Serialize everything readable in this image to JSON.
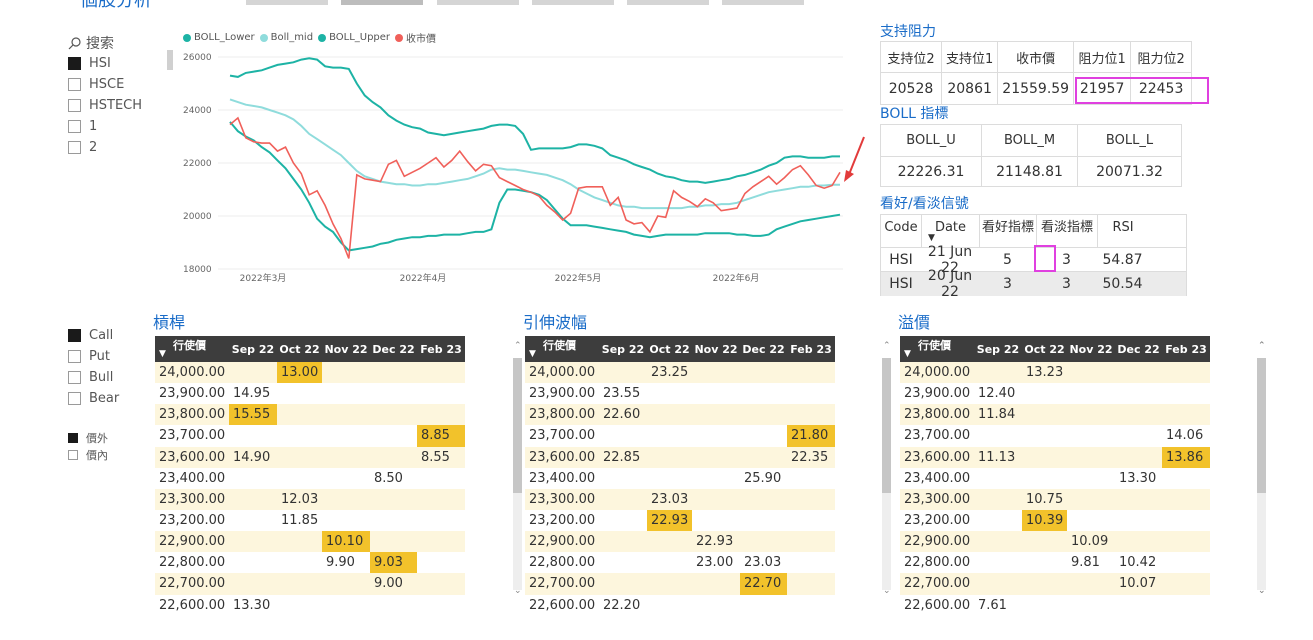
{
  "header": {
    "title": "個股分析"
  },
  "slicer": {
    "search_placeholder": "搜索",
    "items": [
      {
        "label": "HSI",
        "checked": true
      },
      {
        "label": "HSCE",
        "checked": false
      },
      {
        "label": "HSTECH",
        "checked": false
      },
      {
        "label": "1",
        "checked": false
      },
      {
        "label": "2",
        "checked": false
      }
    ]
  },
  "type_slicer": {
    "items": [
      {
        "label": "Call",
        "checked": true
      },
      {
        "label": "Put",
        "checked": false
      },
      {
        "label": "Bull",
        "checked": false
      },
      {
        "label": "Bear",
        "checked": false
      }
    ]
  },
  "money_slicer": {
    "items": [
      {
        "label": "價外",
        "checked": true
      },
      {
        "label": "價內",
        "checked": false
      }
    ]
  },
  "chart_data": {
    "type": "line",
    "legend": [
      "BOLL_Lower",
      "Boll_mid",
      "BOLL_Upper",
      "收市價"
    ],
    "legend_position": "top-left",
    "colors": {
      "BOLL_Lower": "#1db3a5",
      "Boll_mid": "#8fdcdc",
      "BOLL_Upper": "#1db3a5",
      "收市價": "#f0605a"
    },
    "yticks": [
      "26000",
      "24000",
      "22000",
      "20000",
      "18000"
    ],
    "ylim": [
      18000,
      26000
    ],
    "xticks": [
      "2022年3月",
      "2022年4月",
      "2022年5月",
      "2022年6月"
    ],
    "grid": true,
    "series": [
      {
        "name": "BOLL_Upper",
        "values": [
          25300,
          25250,
          25400,
          25450,
          25500,
          25600,
          25700,
          25750,
          25800,
          25900,
          25950,
          25900,
          25650,
          25600,
          25600,
          25550,
          25000,
          24550,
          24300,
          24100,
          23800,
          23600,
          23450,
          23350,
          23300,
          23150,
          23100,
          23050,
          23100,
          23150,
          23200,
          23250,
          23300,
          23400,
          23450,
          23450,
          23400,
          23100,
          22500,
          22550,
          22550,
          22550,
          22550,
          22600,
          22700,
          22700,
          22650,
          22550,
          22300,
          22200,
          22100,
          21950,
          21850,
          21750,
          21600,
          21500,
          21450,
          21350,
          21300,
          21300,
          21250,
          21300,
          21350,
          21400,
          21500,
          21550,
          21650,
          21750,
          21900,
          22000,
          22200,
          22250,
          22250,
          22200,
          22200,
          22200,
          22250,
          22250
        ]
      },
      {
        "name": "Boll_mid",
        "values": [
          24400,
          24300,
          24200,
          24150,
          24100,
          24000,
          23900,
          23800,
          23650,
          23400,
          23100,
          22900,
          22700,
          22500,
          22300,
          22000,
          21700,
          21500,
          21400,
          21300,
          21250,
          21200,
          21200,
          21150,
          21150,
          21200,
          21200,
          21250,
          21300,
          21350,
          21400,
          21500,
          21600,
          21750,
          21800,
          21750,
          21750,
          21700,
          21650,
          21600,
          21550,
          21450,
          21350,
          21200,
          21000,
          20850,
          20700,
          20600,
          20500,
          20400,
          20350,
          20350,
          20300,
          20300,
          20300,
          20300,
          20300,
          20300,
          20350,
          20350,
          20400,
          20400,
          20450,
          20450,
          20500,
          20600,
          20700,
          20800,
          20900,
          20950,
          21000,
          21050,
          21100,
          21100,
          21150,
          21150,
          21180,
          21180
        ]
      },
      {
        "name": "BOLL_Lower",
        "values": [
          23550,
          23200,
          23000,
          22850,
          22600,
          22400,
          22100,
          21800,
          21400,
          21000,
          20500,
          19900,
          19600,
          19400,
          19000,
          18700,
          18750,
          18800,
          18850,
          18950,
          19000,
          19100,
          19150,
          19200,
          19200,
          19250,
          19250,
          19300,
          19300,
          19300,
          19350,
          19400,
          19400,
          19500,
          20500,
          21000,
          21000,
          20950,
          20900,
          20800,
          20600,
          20250,
          19900,
          19650,
          19650,
          19650,
          19600,
          19550,
          19500,
          19450,
          19400,
          19300,
          19250,
          19200,
          19250,
          19300,
          19300,
          19300,
          19300,
          19300,
          19350,
          19350,
          19350,
          19350,
          19300,
          19300,
          19250,
          19250,
          19300,
          19500,
          19600,
          19700,
          19800,
          19850,
          19900,
          19950,
          20000,
          20050
        ]
      },
      {
        "name": "收市價",
        "values": [
          23450,
          23700,
          22950,
          22800,
          22750,
          22750,
          22450,
          22600,
          22000,
          21600,
          20800,
          20950,
          20400,
          19700,
          19150,
          18400,
          21550,
          21400,
          21350,
          21300,
          21950,
          22100,
          21500,
          21650,
          21800,
          22000,
          22200,
          21850,
          22100,
          22450,
          22050,
          21700,
          21950,
          21900,
          21450,
          21300,
          21150,
          21000,
          20900,
          20750,
          20400,
          20150,
          19850,
          20100,
          21050,
          21100,
          21100,
          21100,
          20400,
          20700,
          19850,
          19700,
          19750,
          19400,
          20000,
          19950,
          20950,
          20700,
          20550,
          20350,
          20650,
          20500,
          20200,
          20250,
          20300,
          20850,
          21100,
          21300,
          21500,
          21200,
          21450,
          21750,
          21900,
          21550,
          21150,
          21050,
          21150,
          21650
        ]
      }
    ]
  },
  "support_resistance": {
    "title": "支持阻力",
    "headers": [
      "支持位2",
      "支持位1",
      "收市價",
      "阻力位1",
      "阻力位2"
    ],
    "values": [
      "20528",
      "20861",
      "21559.59",
      "21957",
      "22453"
    ]
  },
  "boll": {
    "title": "BOLL 指標",
    "headers": [
      "BOLL_U",
      "BOLL_M",
      "BOLL_L"
    ],
    "values": [
      "22226.31",
      "21148.81",
      "20071.32"
    ]
  },
  "signal": {
    "title": "看好/看淡信號",
    "headers": [
      "Code",
      "Date",
      "看好指標",
      "看淡指標",
      "RSI"
    ],
    "rows": [
      [
        "HSI",
        "21 Jun 22",
        "5",
        "3",
        "54.87"
      ],
      [
        "HSI",
        "20 Jun 22",
        "3",
        "3",
        "50.54"
      ]
    ]
  },
  "matrices": [
    {
      "title": "槓桿",
      "first_header": "行使價",
      "months": [
        "Sep 22",
        "Oct 22",
        "Nov 22",
        "Dec 22",
        "Feb 23"
      ],
      "rows": [
        [
          "24,000.00",
          "",
          "13.00",
          "",
          "",
          ""
        ],
        [
          "23,900.00",
          "14.95",
          "",
          "",
          "",
          ""
        ],
        [
          "23,800.00",
          "15.55",
          "",
          "",
          "",
          ""
        ],
        [
          "23,700.00",
          "",
          "",
          "",
          "",
          "8.85"
        ],
        [
          "23,600.00",
          "14.90",
          "",
          "",
          "",
          "8.55"
        ],
        [
          "23,400.00",
          "",
          "",
          "",
          "8.50",
          ""
        ],
        [
          "23,300.00",
          "",
          "12.03",
          "",
          "",
          ""
        ],
        [
          "23,200.00",
          "",
          "11.85",
          "",
          "",
          ""
        ],
        [
          "22,900.00",
          "",
          "",
          "10.10",
          "",
          ""
        ],
        [
          "22,800.00",
          "",
          "",
          "9.90",
          "9.03",
          ""
        ],
        [
          "22,700.00",
          "",
          "",
          "",
          "9.00",
          ""
        ],
        [
          "22,600.00",
          "13.30",
          "",
          "",
          "",
          ""
        ]
      ],
      "highlights": [
        [
          0,
          2
        ],
        [
          2,
          1
        ],
        [
          3,
          5
        ],
        [
          8,
          3
        ],
        [
          9,
          4
        ]
      ]
    },
    {
      "title": "引伸波幅",
      "first_header": "行使價",
      "months": [
        "Sep 22",
        "Oct 22",
        "Nov 22",
        "Dec 22",
        "Feb 23"
      ],
      "rows": [
        [
          "24,000.00",
          "",
          "23.25",
          "",
          "",
          ""
        ],
        [
          "23,900.00",
          "23.55",
          "",
          "",
          "",
          ""
        ],
        [
          "23,800.00",
          "22.60",
          "",
          "",
          "",
          ""
        ],
        [
          "23,700.00",
          "",
          "",
          "",
          "",
          "21.80"
        ],
        [
          "23,600.00",
          "22.85",
          "",
          "",
          "",
          "22.35"
        ],
        [
          "23,400.00",
          "",
          "",
          "",
          "25.90",
          ""
        ],
        [
          "23,300.00",
          "",
          "23.03",
          "",
          "",
          ""
        ],
        [
          "23,200.00",
          "",
          "22.93",
          "",
          "",
          ""
        ],
        [
          "22,900.00",
          "",
          "",
          "22.93",
          "",
          ""
        ],
        [
          "22,800.00",
          "",
          "",
          "23.00",
          "23.03",
          ""
        ],
        [
          "22,700.00",
          "",
          "",
          "",
          "22.70",
          ""
        ],
        [
          "22,600.00",
          "22.20",
          "",
          "",
          "",
          ""
        ]
      ],
      "highlights": [
        [
          3,
          5
        ],
        [
          7,
          2
        ],
        [
          10,
          4
        ]
      ]
    },
    {
      "title": "溢價",
      "first_header": "行使價",
      "months": [
        "Sep 22",
        "Oct 22",
        "Nov 22",
        "Dec 22",
        "Feb 23"
      ],
      "rows": [
        [
          "24,000.00",
          "",
          "13.23",
          "",
          "",
          ""
        ],
        [
          "23,900.00",
          "12.40",
          "",
          "",
          "",
          ""
        ],
        [
          "23,800.00",
          "11.84",
          "",
          "",
          "",
          ""
        ],
        [
          "23,700.00",
          "",
          "",
          "",
          "",
          "14.06"
        ],
        [
          "23,600.00",
          "11.13",
          "",
          "",
          "",
          "13.86"
        ],
        [
          "23,400.00",
          "",
          "",
          "",
          "13.30",
          ""
        ],
        [
          "23,300.00",
          "",
          "10.75",
          "",
          "",
          ""
        ],
        [
          "23,200.00",
          "",
          "10.39",
          "",
          "",
          ""
        ],
        [
          "22,900.00",
          "",
          "",
          "10.09",
          "",
          ""
        ],
        [
          "22,800.00",
          "",
          "",
          "9.81",
          "10.42",
          ""
        ],
        [
          "22,700.00",
          "",
          "",
          "",
          "10.07",
          ""
        ],
        [
          "22,600.00",
          "7.61",
          "",
          "",
          "",
          ""
        ]
      ],
      "highlights": [
        [
          4,
          5
        ],
        [
          7,
          2
        ]
      ]
    }
  ]
}
